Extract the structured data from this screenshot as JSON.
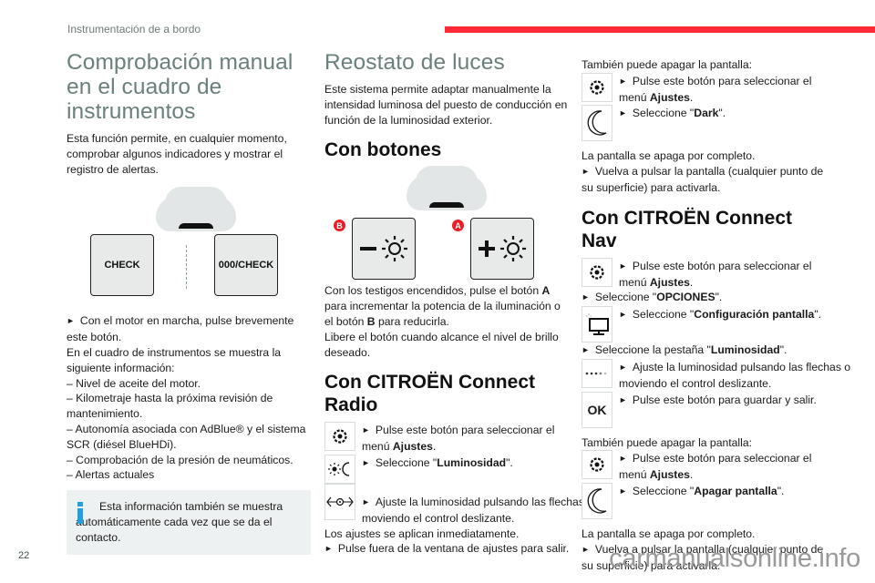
{
  "header": {
    "section_title": "Instrumentación de a bordo",
    "accent_color": "#ff2a35"
  },
  "col1": {
    "title": "Comprobación manual en el cuadro de instrumentos",
    "intro": "Esta función permite, en cualquier momento, comprobar algunos indicadores y mostrar el registro de alertas.",
    "figure": {
      "button_left": "CHECK",
      "button_right": "000/CHECK"
    },
    "step": "Con el motor en marcha, pulse brevemente este botón.",
    "info_line": "En el cuadro de instrumentos se muestra la siguiente información:",
    "list": [
      "Nivel de aceite del motor.",
      "Kilometraje hasta la próxima revisión de mantenimiento.",
      "Autonomía asociada con AdBlue® y el sistema SCR (diésel BlueHDi).",
      "Comprobación de la presión de neumáticos.",
      "Alertas actuales"
    ],
    "note": "Esta información también se muestra automáticamente cada vez que se da el contacto."
  },
  "col2": {
    "title": "Reostato de luces",
    "intro": "Este sistema permite adaptar manualmente la intensidad luminosa del puesto de conducción en función de la luminosidad exterior.",
    "h_buttons": "Con botones",
    "badge_b": "B",
    "badge_a": "A",
    "buttons_text_1": "Con los testigos encendidos, pulse el botón ",
    "buttons_a": "A",
    "buttons_text_2": " para incrementar la potencia de la iluminación o el botón ",
    "buttons_b": "B",
    "buttons_text_3": " para reducirla.",
    "buttons_text_4": "Libere el botón cuando alcance el nivel de brillo deseado.",
    "h_radio": "Con CITROËN Connect Radio",
    "radio_step1_a": "Pulse este botón para seleccionar el menú ",
    "radio_step1_b": "Ajustes",
    "radio_step2_a": "Seleccione \"",
    "radio_step2_b": "Luminosidad",
    "radio_step3": "Ajuste la luminosidad pulsando las flechas o moviendo el control deslizante.",
    "radio_line": "Los ajustes se aplican inmediatamente.",
    "radio_step4": "Pulse fuera de la ventana de ajustes para salir."
  },
  "col3": {
    "also_off": "También puede apagar la pantalla:",
    "step1_a": "Pulse este botón para seleccionar el menú ",
    "step1_b": "Ajustes",
    "dark_a": "Seleccione \"",
    "dark_b": "Dark",
    "off_line": "La pantalla se apaga por completo.",
    "reactivate": "Vuelva a pulsar la pantalla (cualquier punto de su superficie) para activarla.",
    "h_nav": "Con CITROËN Connect Nav",
    "nav_step1_a": "Pulse este botón para seleccionar el menú ",
    "nav_step1_b": "Ajustes",
    "nav_step2_a": "Seleccione \"",
    "nav_step2_b": "OPCIONES",
    "nav_step3_a": "Seleccione \"",
    "nav_step3_b": "Configuración pantalla",
    "nav_step4_a": "Seleccione la pestaña \"",
    "nav_step4_b": "Luminosidad",
    "nav_step5": "Ajuste la luminosidad pulsando las flechas o moviendo el control deslizante.",
    "ok_label": "OK",
    "nav_step6": "Pulse este botón para guardar y salir.",
    "also_off2": "También puede apagar la pantalla:",
    "off2_step1_a": "Pulse este botón para seleccionar el menú ",
    "off2_step1_b": "Ajustes",
    "off2_step2_a": "Seleccione \"",
    "off2_step2_b": "Apagar pantalla",
    "off_line2": "La pantalla se apaga por completo.",
    "reactivate2": "Vuelva a pulsar la pantalla (cualquier punto de su superficie) para activarla."
  },
  "footer": {
    "page_number": "22",
    "watermark": "carmanualsonline.info"
  }
}
